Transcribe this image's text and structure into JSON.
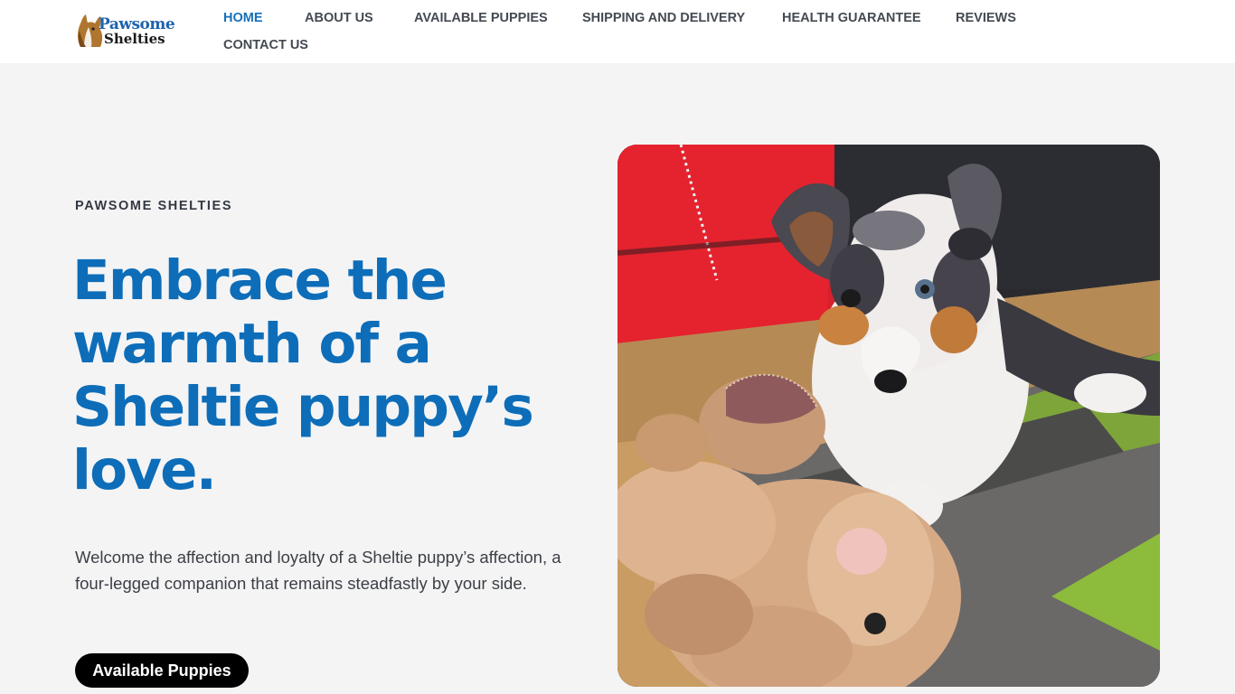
{
  "brand": {
    "logo_line1": "Pawsome",
    "logo_line2": "Shelties",
    "logo_icon": "sheltie-head-icon"
  },
  "nav": {
    "items": [
      {
        "label": "HOME",
        "active": true
      },
      {
        "label": "ABOUT US",
        "active": false
      },
      {
        "label": "AVAILABLE PUPPIES",
        "active": false
      },
      {
        "label": "SHIPPING AND DELIVERY",
        "active": false
      },
      {
        "label": "HEALTH GUARANTEE",
        "active": false
      },
      {
        "label": "REVIEWS",
        "active": false
      },
      {
        "label": "CONTACT US",
        "active": false
      }
    ]
  },
  "hero": {
    "eyebrow": "PAWSOME SHELTIES",
    "headline": "Embrace the warmth of a Sheltie puppy’s love.",
    "lede": "Welcome the affection and loyalty of a Sheltie puppy’s affection, a four-legged companion that remains steadfastly by your side.",
    "cta_label": "Available Puppies",
    "image_subject": "sheltie-puppy-with-teddy-bear-photo"
  },
  "colors": {
    "accent": "#1570b9",
    "headline": "#0d6db8",
    "page_bg": "#f4f4f5",
    "header_bg": "#ffffff",
    "button_bg": "#000000",
    "button_text": "#ffffff",
    "body_text": "#3b3f45"
  }
}
